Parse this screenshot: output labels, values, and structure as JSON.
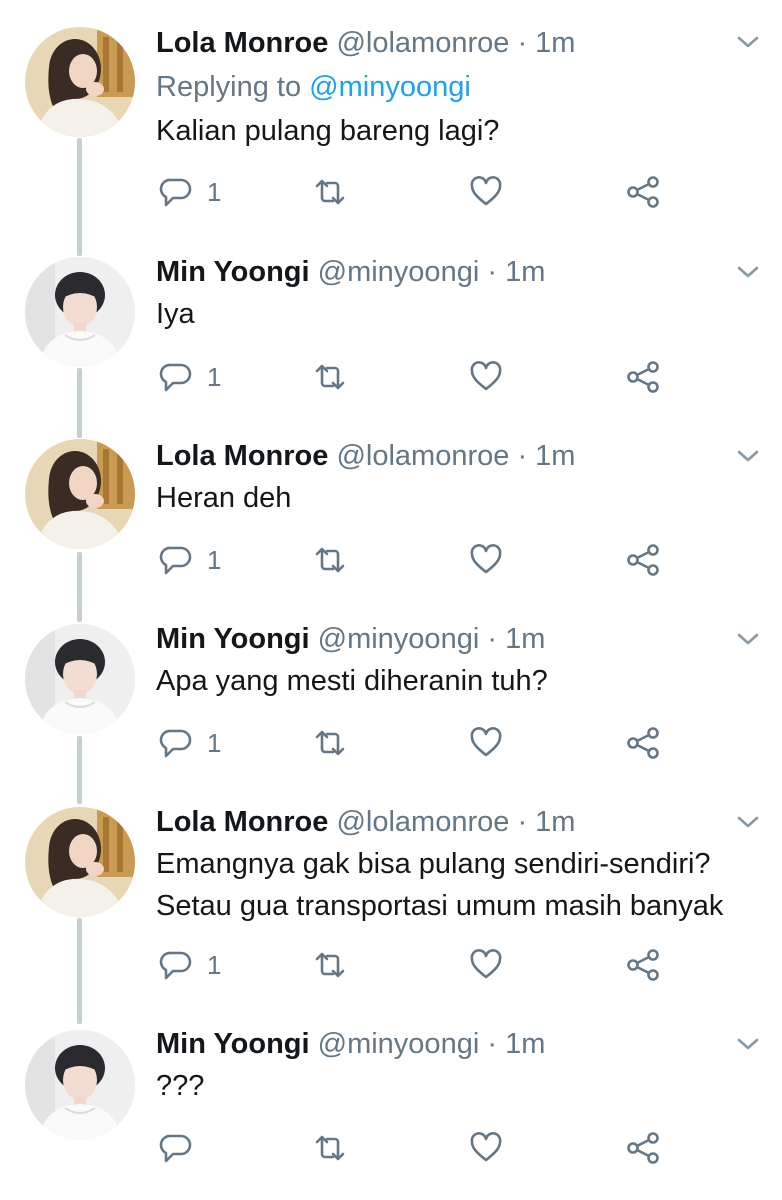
{
  "colors": {
    "text": "#14171a",
    "secondary": "#657786",
    "link": "#1da1f2",
    "thread_line": "#c4cfd6",
    "icon": "#657786"
  },
  "icons": {
    "more": "chevron-down-icon",
    "reply": "reply-icon",
    "retweet": "retweet-icon",
    "like": "heart-icon",
    "share": "share-icon"
  },
  "tweets": [
    {
      "name": "Lola Monroe",
      "handle": "@lolamonroe",
      "dot": "·",
      "time": "1m",
      "replying_label": "Replying to",
      "replying_handle": "@minyoongi",
      "text": [
        "Kalian pulang bareng lagi?"
      ],
      "reply_count": "1",
      "avatar": "lola"
    },
    {
      "name": "Min Yoongi",
      "handle": "@minyoongi",
      "dot": "·",
      "time": "1m",
      "text": [
        "Iya"
      ],
      "reply_count": "1",
      "avatar": "yoongi"
    },
    {
      "name": "Lola Monroe",
      "handle": "@lolamonroe",
      "dot": "·",
      "time": "1m",
      "text": [
        "Heran deh"
      ],
      "reply_count": "1",
      "avatar": "lola"
    },
    {
      "name": "Min Yoongi",
      "handle": "@minyoongi",
      "dot": "·",
      "time": "1m",
      "text": [
        "Apa yang mesti diheranin tuh?"
      ],
      "reply_count": "1",
      "avatar": "yoongi"
    },
    {
      "name": "Lola Monroe",
      "handle": "@lolamonroe",
      "dot": "·",
      "time": "1m",
      "text": [
        "Emangnya gak bisa pulang sendiri-sendiri?",
        "Setau gua transportasi umum masih banyak"
      ],
      "reply_count": "1",
      "avatar": "lola"
    },
    {
      "name": "Min Yoongi",
      "handle": "@minyoongi",
      "dot": "·",
      "time": "1m",
      "text": [
        "???"
      ],
      "reply_count": "",
      "avatar": "yoongi"
    }
  ]
}
